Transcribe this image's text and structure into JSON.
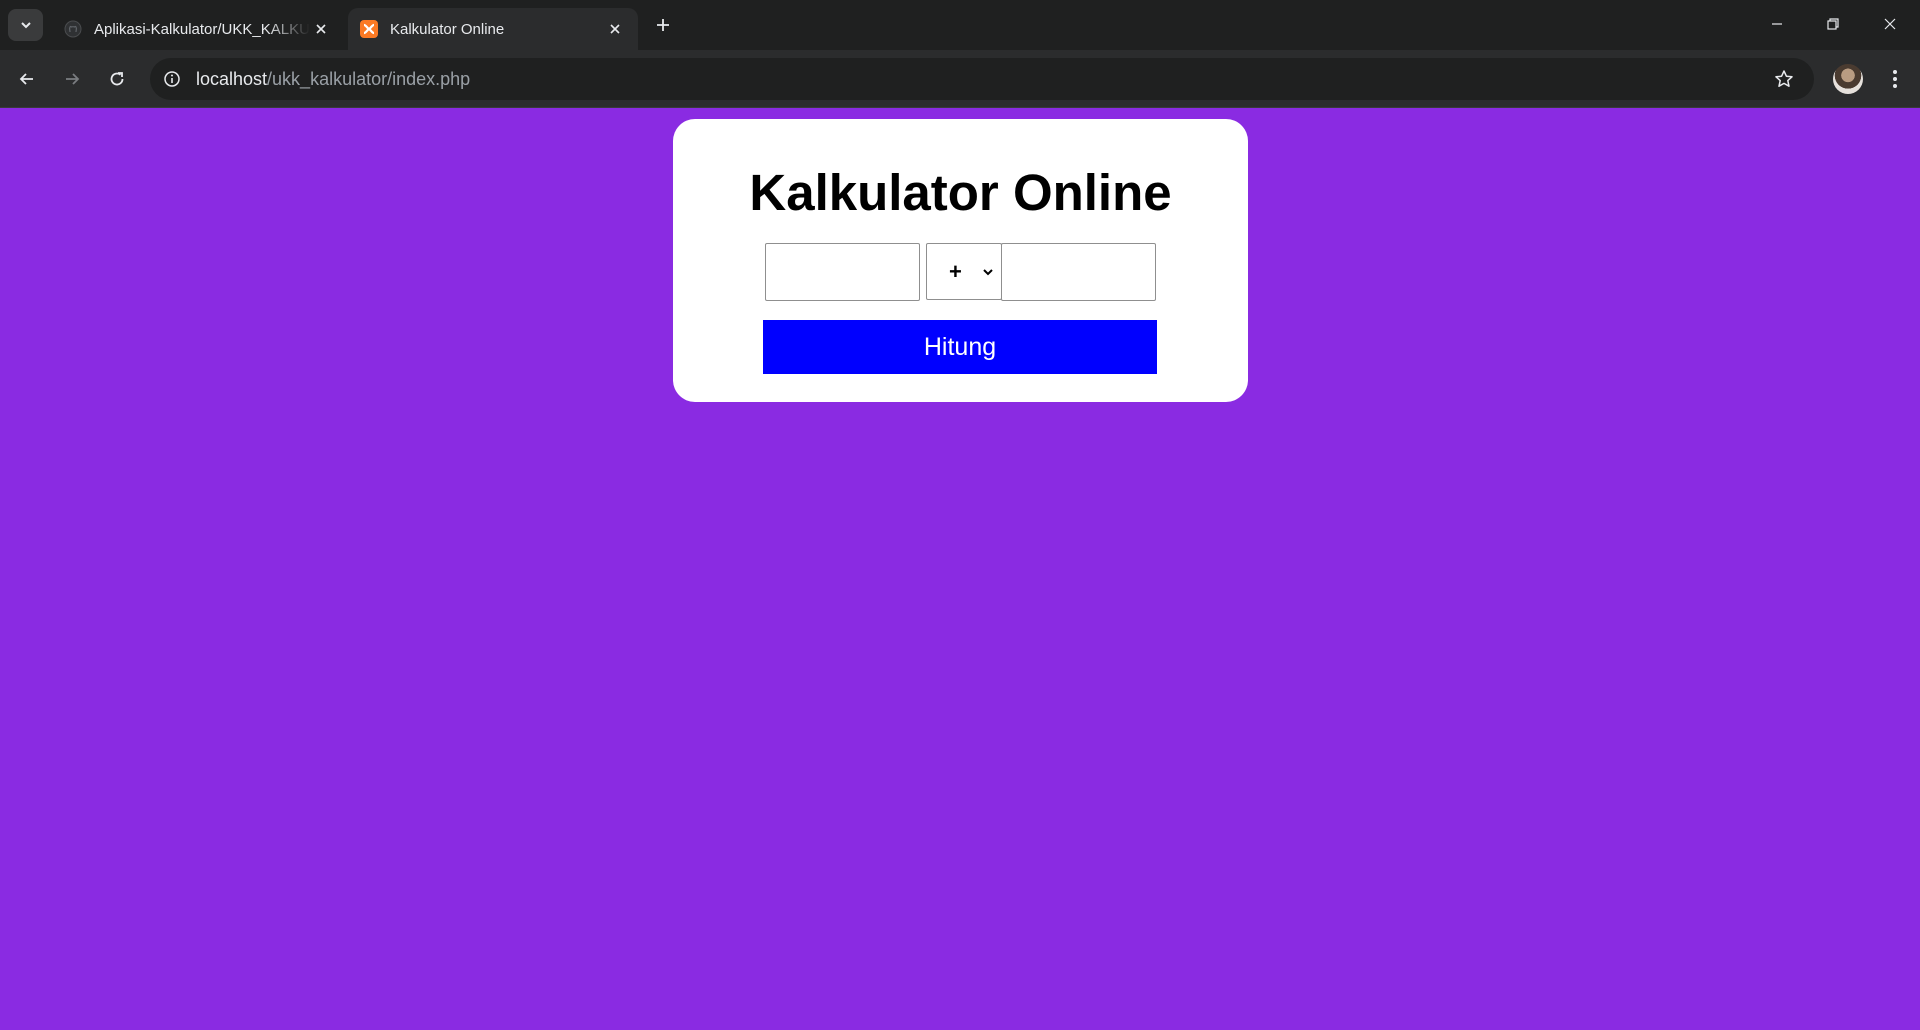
{
  "browser": {
    "tabs": [
      {
        "title": "Aplikasi-Kalkulator/UKK_KALKU",
        "favicon": "github-icon",
        "active": false
      },
      {
        "title": "Kalkulator Online",
        "favicon": "xampp-icon",
        "active": true
      }
    ],
    "url": {
      "host": "localhost",
      "path": "/ukk_kalkulator/index.php"
    }
  },
  "calculator": {
    "title": "Kalkulator Online",
    "first_number": "",
    "operator": "+",
    "second_number": "",
    "submit_label": "Hitung"
  },
  "colors": {
    "page_background": "#8a2be2",
    "card_background": "#ffffff",
    "button_background": "#0000ff",
    "button_text": "#ffffff"
  }
}
